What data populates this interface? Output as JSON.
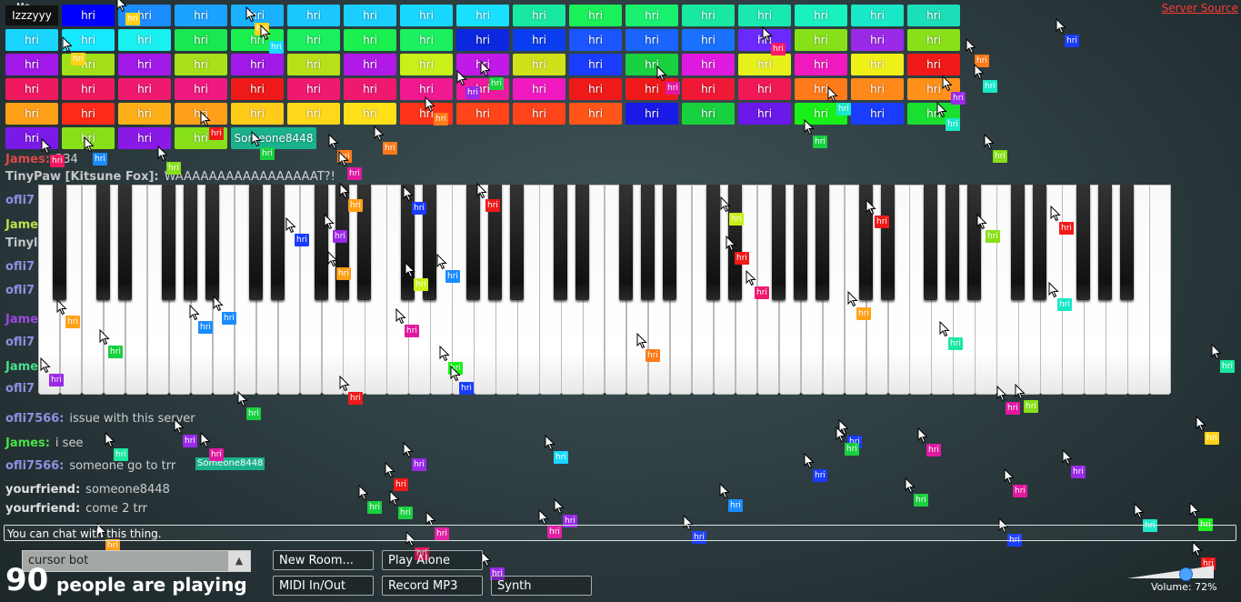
{
  "header": {
    "me_label": "Me",
    "me_name": "Izzzyyy",
    "server_source": "Server Source"
  },
  "participants": {
    "label": "hri",
    "rows": [
      [
        "#1a7cff",
        "#0000ff",
        "#1a8cff",
        "#1aa3ff",
        "#1ab2ff",
        "#1ac8ff",
        "#1acfff",
        "#19d8ff",
        "#19e0ff",
        "#19e8a0",
        "#19f05a",
        "#1af070",
        "#19e8a0",
        "#19e8b0",
        "#19f0c0",
        "#19e8c8",
        "#1adfb8"
      ],
      [
        "#19d5ff",
        "#15e8ff",
        "#19f0f0",
        "#1ae850",
        "#1af050",
        "#1af060",
        "#1af050",
        "#1af060",
        "#0b28e0",
        "#0b3df0",
        "#1a55ff",
        "#1a65ff",
        "#1a70ff",
        "#6a2aff",
        "#88e019",
        "#9a29e8",
        "#88e019"
      ],
      [
        "#a019e8",
        "#a3e019",
        "#a019e8",
        "#a8e019",
        "#a019e8",
        "#b8e019",
        "#b019e8",
        "#c8f019",
        "#c019e8",
        "#d0e019",
        "#1a3cff",
        "#19d040",
        "#e019e0",
        "#e8f019",
        "#f019c0",
        "#f0f019",
        "#f01919"
      ],
      [
        "#f01960",
        "#f01960",
        "#f01970",
        "#f01980",
        "#f01919",
        "#f01970",
        "#f01970",
        "#f01990",
        "#f019a0",
        "#f019c0",
        "#f01919",
        "#f01919",
        "#f01935",
        "#f01955",
        "#ff7a19",
        "#ff8a19",
        "#ff9019"
      ],
      [
        "#ffa019",
        "#ff2a19",
        "#ffb019",
        "#ffa019",
        "#ffcc19",
        "#ffd819",
        "#ffe019",
        "#ff3319",
        "#ff4419",
        "#ff4419",
        "#ff5519",
        "#1a1ae8",
        "#19d040",
        "#6a19e8",
        "#19f019",
        "#1a3cff",
        "#19e030"
      ],
      [
        "#7a19e8",
        "#88e019",
        "#8a19e8",
        "#88e019"
      ]
    ],
    "extra_name": "Someone8448"
  },
  "chat": {
    "lines": [
      {
        "name": "James:",
        "name_color": "#ff4d4d",
        "text": "334"
      },
      {
        "name": "TinyPaw [Kitsune Fox]:",
        "name_color": "#e0e0e0",
        "text": "WAAAAAAAAAAAAAAAAAT?!"
      },
      {
        "name": "ofli7",
        "name_color": "#a0a0ff",
        "text": ""
      },
      {
        "name": "James",
        "name_color": "#d7ff4d",
        "text": ""
      },
      {
        "name": "Tinyl",
        "name_color": "#e0e0e0",
        "text": ""
      },
      {
        "name": "ofli7",
        "name_color": "#a0a0ff",
        "text": ""
      },
      {
        "name": "ofli7",
        "name_color": "#a0a0ff",
        "text": ""
      },
      {
        "name": "Jame",
        "name_color": "#b04dff",
        "text": ""
      },
      {
        "name": "ofli7",
        "name_color": "#a0a0ff",
        "text": ""
      },
      {
        "name": "Jame",
        "name_color": "#4dff9a",
        "text": ""
      },
      {
        "name": "ofli7",
        "name_color": "#a0a0ff",
        "text": ""
      },
      {
        "name": "ofli7566:",
        "name_color": "#a0a0ff",
        "text": "issue with this server"
      },
      {
        "name": "James:",
        "name_color": "#4dff4d",
        "text": "i see"
      },
      {
        "name": "ofli7566:",
        "name_color": "#a0a0ff",
        "text": "someone go to trr"
      },
      {
        "name": "yourfriend:",
        "name_color": "#ffffff",
        "text": "someone8448"
      },
      {
        "name": "yourfriend:",
        "name_color": "#ffffff",
        "text": "come 2 trr"
      }
    ],
    "input_placeholder": "You can chat with this thing.",
    "floating_name": "Someone8448"
  },
  "piano": {
    "white_keys": 52
  },
  "cursors": {
    "tag_label": "hri"
  },
  "controls": {
    "room": "cursor bot",
    "room_arrow": "▲",
    "player_count": "90",
    "player_count_label": "people are playing",
    "new_room": "New Room...",
    "play_alone": "Play Alone",
    "midi": "MIDI In/Out",
    "record": "Record MP3",
    "synth": "Synth",
    "volume_label": "Volume: 72%",
    "volume": 0.72,
    "volume_color": "#ff6a19"
  }
}
